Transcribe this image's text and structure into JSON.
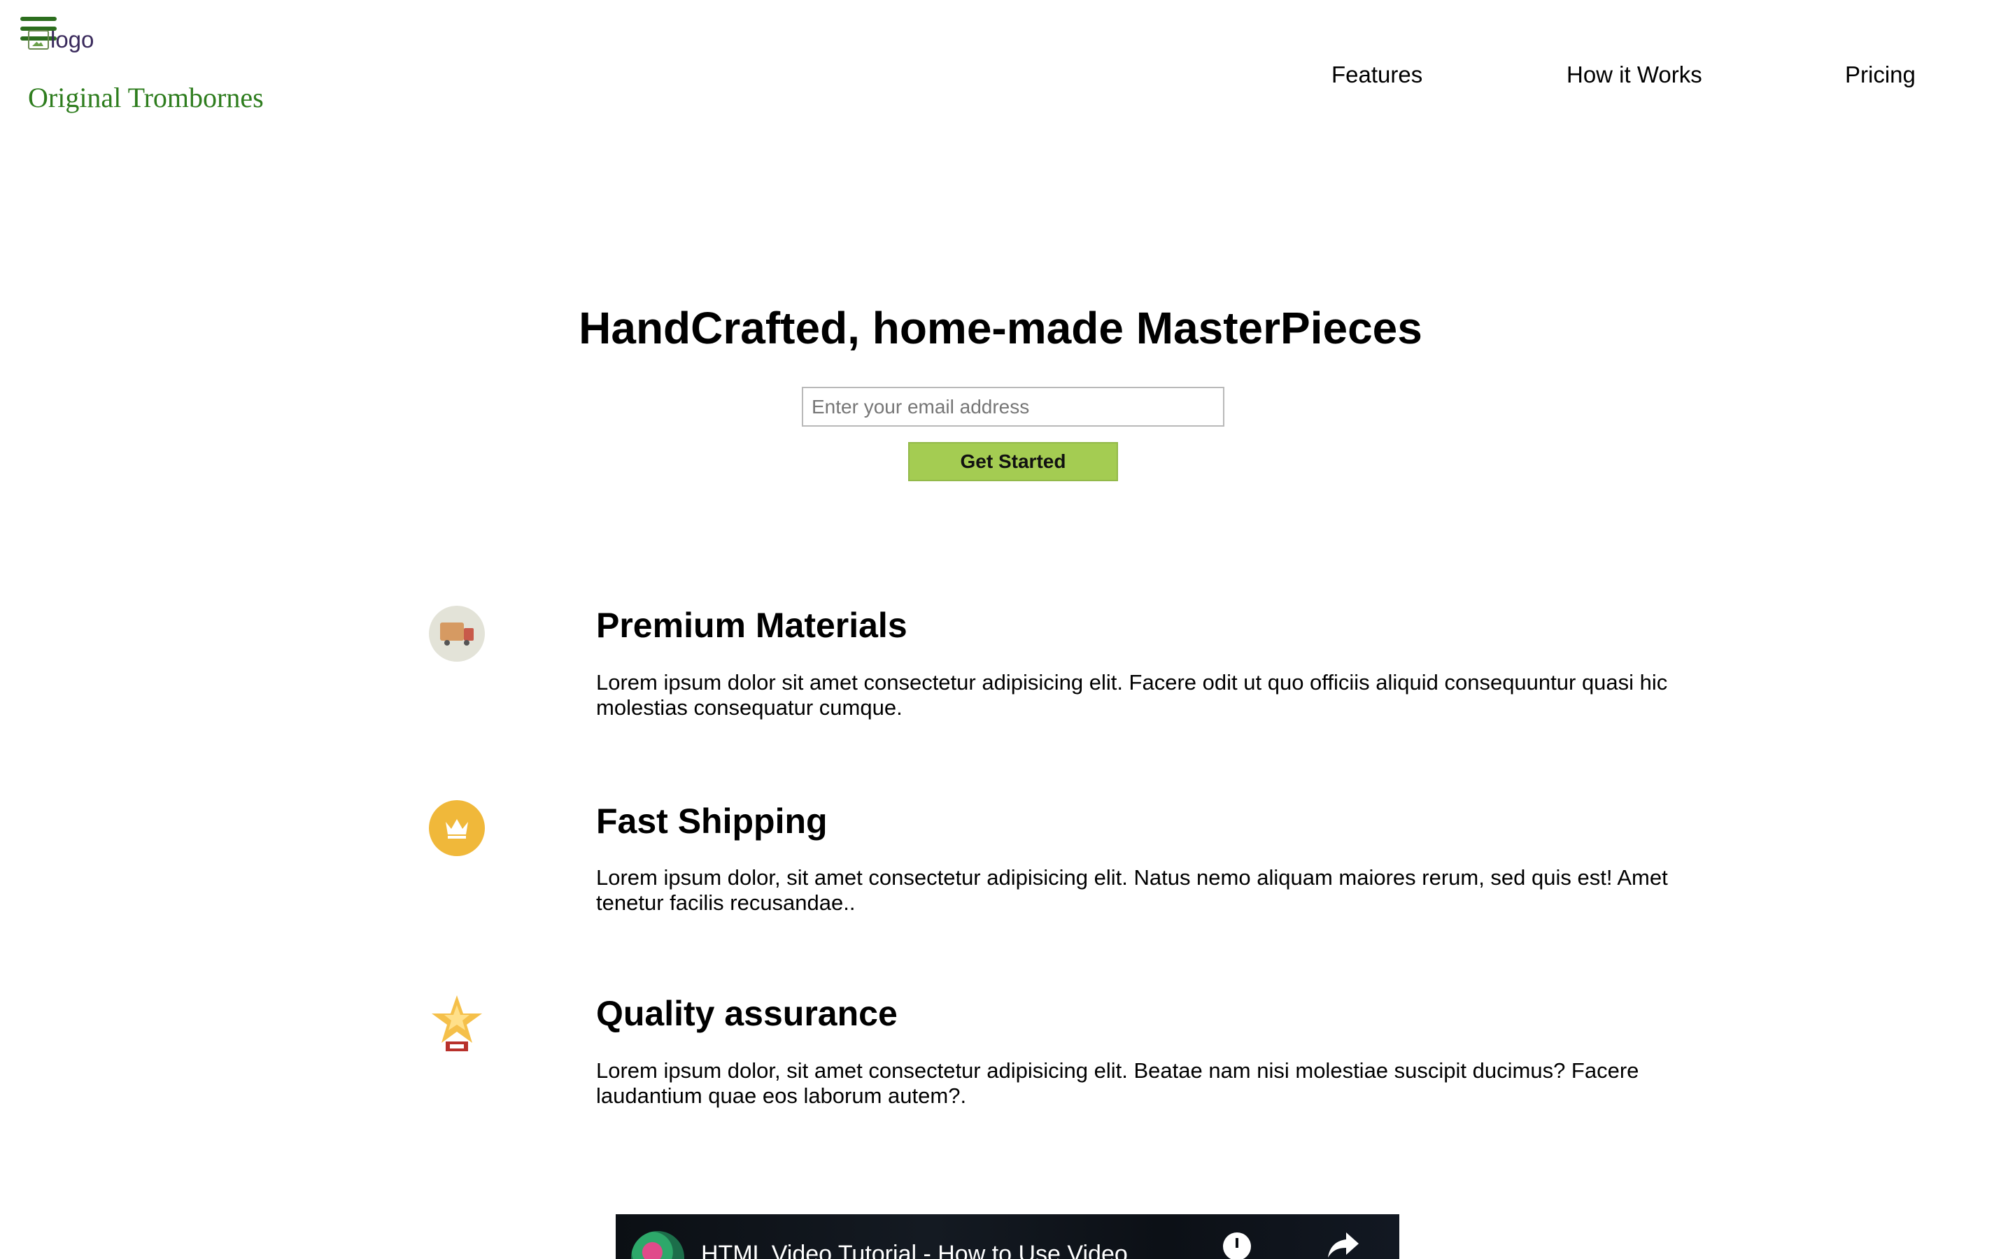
{
  "header": {
    "logo_alt": "logo",
    "brand": "Original Trombornes",
    "nav": [
      "Features",
      "How it Works",
      "Pricing"
    ]
  },
  "hero": {
    "title": "HandCrafted, home-made MasterPieces",
    "email_placeholder": "Enter your email address",
    "button_label": "Get Started"
  },
  "features": [
    {
      "icon": "truck-icon",
      "title": "Premium Materials",
      "text": "Lorem ipsum dolor sit amet consectetur adipisicing elit. Facere odit ut quo officiis aliquid consequuntur quasi hic molestias consequatur cumque."
    },
    {
      "icon": "crown-icon",
      "title": "Fast Shipping",
      "text": "Lorem ipsum dolor, sit amet consectetur adipisicing elit. Natus nemo aliquam maiores rerum, sed quis est! Amet tenetur facilis recusandae.."
    },
    {
      "icon": "star-trophy-icon",
      "title": "Quality assurance",
      "text": "Lorem ipsum dolor, sit amet consectetur adipisicing elit. Beatae nam nisi molestiae suscipit ducimus? Facere laudantium quae eos laborum autem?."
    }
  ],
  "video": {
    "title": "HTML Video Tutorial - How to Use Video",
    "icons": [
      "watch-later-icon",
      "share-icon"
    ]
  },
  "colors": {
    "brand_green": "#2e7d1e",
    "button_green": "#a4cc52",
    "hamburger_green": "#2c6e1e"
  }
}
